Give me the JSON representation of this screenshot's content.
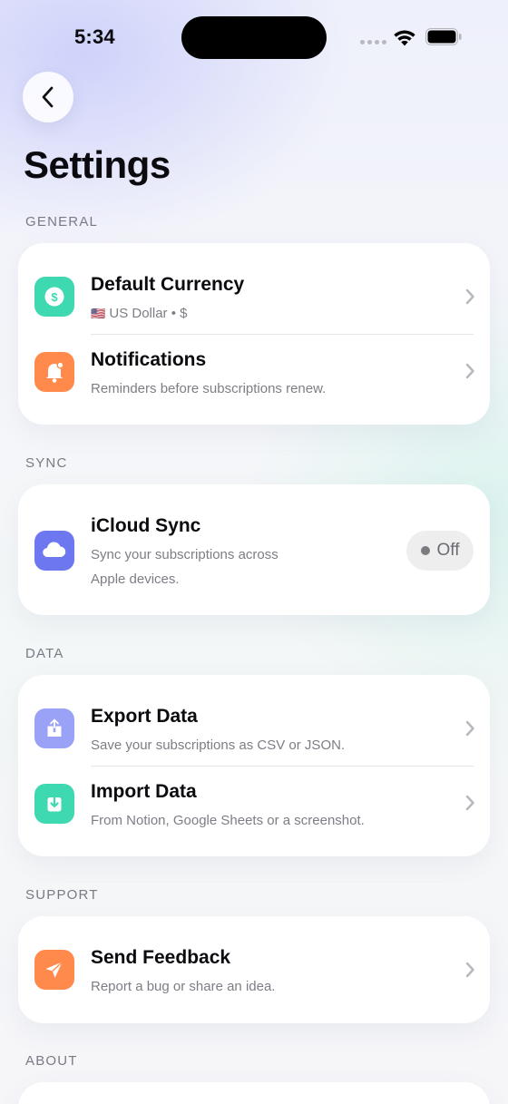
{
  "status_bar": {
    "time": "5:34"
  },
  "header": {
    "back_label": "",
    "title": "Settings"
  },
  "sections": {
    "general": {
      "label": "GENERAL",
      "currency": {
        "title": "Default Currency",
        "flag": "🇺🇸",
        "subtitle": "US Dollar • $"
      },
      "notifications": {
        "title": "Notifications",
        "subtitle": "Reminders before subscriptions renew."
      }
    },
    "sync": {
      "label": "SYNC",
      "icloud": {
        "title": "iCloud Sync",
        "subtitle_line1": "Sync your subscriptions across",
        "subtitle_line2": "Apple devices.",
        "toggle_label": "Off"
      }
    },
    "data": {
      "label": "DATA",
      "export": {
        "title": "Export Data",
        "subtitle": "Save your subscriptions as CSV or JSON."
      },
      "import": {
        "title": "Import Data",
        "subtitle": "From Notion, Google Sheets or a screenshot."
      }
    },
    "support": {
      "label": "SUPPORT",
      "feedback": {
        "title": "Send Feedback",
        "subtitle": "Report a bug or share an idea."
      }
    },
    "about": {
      "label": "ABOUT"
    }
  },
  "icons": {
    "currency": "dollar-icon",
    "notifications": "bell-icon",
    "icloud": "cloud-icon",
    "export": "export-icon",
    "import": "import-icon",
    "feedback": "paper-plane-icon"
  },
  "colors": {
    "currency_icon": "#3ed9b0",
    "notifications_icon": "#ff8a4c",
    "icloud_icon": "#6d78f0",
    "export_icon": "#9aa2f7",
    "import_icon": "#3ed9b0",
    "feedback_icon": "#ff8a4c"
  }
}
